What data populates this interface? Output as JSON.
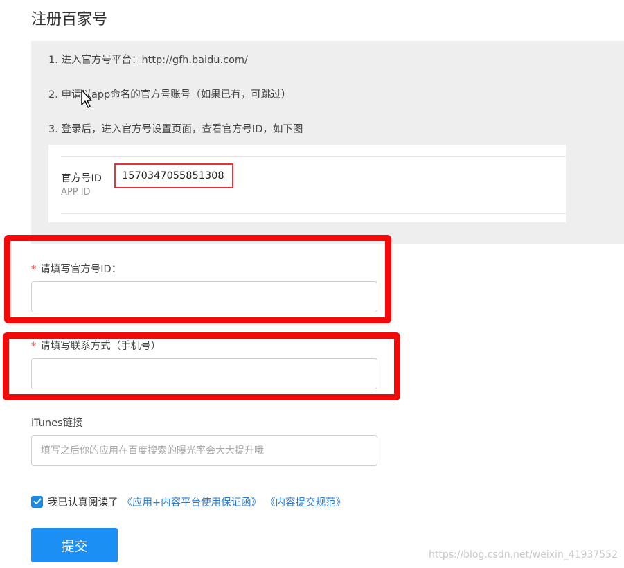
{
  "page": {
    "title": "注册百家号"
  },
  "guide": {
    "steps": [
      "1. 进入官方号平台：http://gfh.baidu.com/",
      "2. 申请以app命名的官方号账号（如果已有，可跳过）",
      "3. 登录后，进入官方号设置页面，查看官方号ID，如下图"
    ],
    "id_card": {
      "label": "官方号ID",
      "sublabel": "APP ID",
      "value": "1570347055851308"
    }
  },
  "form": {
    "required_mark": "*",
    "official_id": {
      "label": "请填写官方号ID：",
      "value": "",
      "placeholder": ""
    },
    "contact": {
      "label": "请填写联系方式（手机号）",
      "value": "",
      "placeholder": ""
    },
    "itunes": {
      "label": "iTunes链接",
      "value": "",
      "placeholder": "填写之后你的应用在百度搜索的曝光率会大大提升哦"
    },
    "agreement": {
      "checked": true,
      "text": "我已认真阅读了",
      "link_1": "《应用+内容平台使用保证函》",
      "link_2": "《内容提交规范》"
    },
    "submit_label": "提交"
  },
  "watermark": "https://blog.csdn.net/weixin_41937552",
  "colors": {
    "annotation_red": "#f20a0a",
    "primary_blue": "#1c8ff5",
    "link_blue": "#2a7bd6",
    "guide_bg": "#eeeeee"
  },
  "icons": {
    "cursor": "mouse-pointer-icon",
    "check": "checkmark-icon"
  }
}
